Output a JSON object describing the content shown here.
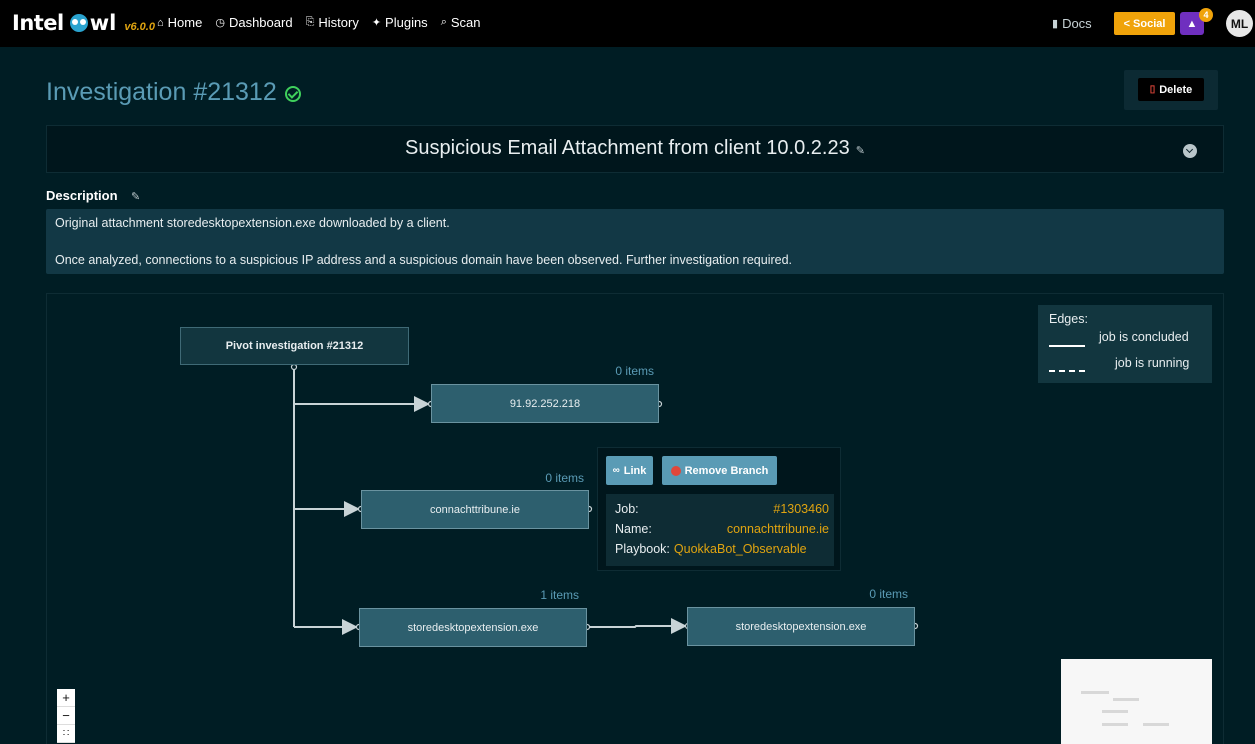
{
  "navbar": {
    "brand_intel": "Intel",
    "brand_owl": "wl",
    "version": "v6.0.0",
    "links": [
      {
        "icon": "home-icon",
        "glyph": "⌂",
        "label": "Home"
      },
      {
        "icon": "dashboard-icon",
        "glyph": "◷",
        "label": "Dashboard"
      },
      {
        "icon": "history-icon",
        "glyph": "⎘",
        "label": "History"
      },
      {
        "icon": "plugins-icon",
        "glyph": "✦",
        "label": "Plugins"
      },
      {
        "icon": "search-icon",
        "glyph": "⌕",
        "label": "Scan"
      }
    ],
    "docs_label": "Docs",
    "social_label": "Social",
    "notifications_count": "4",
    "avatar_initials": "ML"
  },
  "investigation": {
    "title": "Investigation #21312",
    "status": "concluded",
    "delete_label": "Delete",
    "name": "Suspicious Email Attachment from client 10.0.2.23",
    "description_label": "Description",
    "description_line1": "Original attachment storedesktopextension.exe downloaded by a client.",
    "description_line2": "Once analyzed, connections to a suspicious IP address and a suspicious domain have been observed. Further investigation required."
  },
  "graph": {
    "root_label": "Pivot investigation #21312",
    "nodes": [
      {
        "label": "91.92.252.218",
        "items": "0 items"
      },
      {
        "label": "connachttribune.ie",
        "items": "0 items"
      },
      {
        "label": "storedesktopextension.exe",
        "items": "1 items"
      },
      {
        "label": "storedesktopextension.exe",
        "items": "0 items"
      }
    ],
    "legend": {
      "title": "Edges:",
      "concluded": "job is concluded",
      "running": "job is running"
    },
    "popover": {
      "link_label": "Link",
      "remove_label": "Remove Branch",
      "job_key": "Job:",
      "job_val": "#1303460",
      "name_key": "Name:",
      "name_val": "connachttribune.ie",
      "playbook_key": "Playbook:",
      "playbook_val": "QuokkaBot_Observable"
    },
    "zoom": {
      "in": "+",
      "out": "−",
      "fit": "∷"
    }
  },
  "colors": {
    "background": "#001d24",
    "accent": "#5a9bb5",
    "orange": "#e0a410",
    "node_fill": "#2d5f6e"
  }
}
